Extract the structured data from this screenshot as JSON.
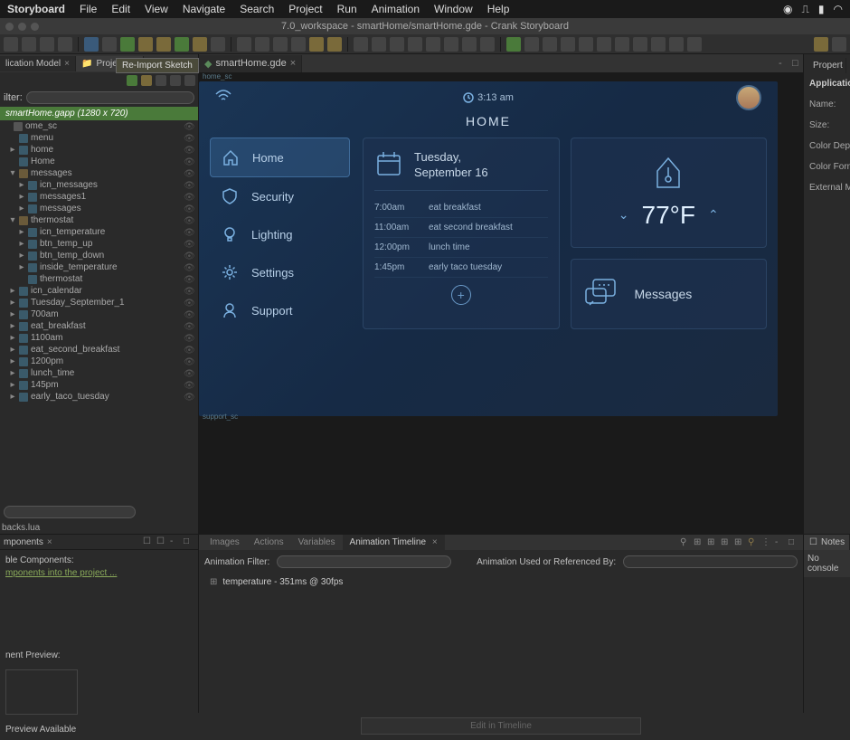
{
  "menubar": {
    "app": "Storyboard",
    "items": [
      "File",
      "Edit",
      "View",
      "Navigate",
      "Search",
      "Project",
      "Run",
      "Animation",
      "Window",
      "Help"
    ]
  },
  "titlebar": "7.0_workspace - smartHome/smartHome.gde - Crank Storyboard",
  "left": {
    "tab1": "lication Model",
    "tab2": "Project Ex",
    "tooltip": "Re-Import Sketch",
    "filter_label": "ilter:",
    "tree_header": "smartHome.gapp (1280 x 720)",
    "tree": [
      {
        "l": 0,
        "t": "",
        "label": "ome_sc"
      },
      {
        "l": 1,
        "t": "",
        "label": "menu",
        "icon": "layer"
      },
      {
        "l": 1,
        "t": "▸",
        "label": "home",
        "icon": "layer"
      },
      {
        "l": 1,
        "t": "",
        "label": "Home",
        "icon": "layer"
      },
      {
        "l": 1,
        "t": "▾",
        "label": "messages",
        "icon": "folder"
      },
      {
        "l": 2,
        "t": "▸",
        "label": "icn_messages",
        "icon": "layer"
      },
      {
        "l": 2,
        "t": "▸",
        "label": "messages1",
        "icon": "layer"
      },
      {
        "l": 2,
        "t": "▸",
        "label": "messages",
        "icon": "layer"
      },
      {
        "l": 1,
        "t": "▾",
        "label": "thermostat",
        "icon": "folder"
      },
      {
        "l": 2,
        "t": "▸",
        "label": "icn_temperature",
        "icon": "layer"
      },
      {
        "l": 2,
        "t": "▸",
        "label": "btn_temp_up",
        "icon": "layer"
      },
      {
        "l": 2,
        "t": "▸",
        "label": "btn_temp_down",
        "icon": "layer"
      },
      {
        "l": 2,
        "t": "▸",
        "label": "inside_temperature",
        "icon": "layer"
      },
      {
        "l": 2,
        "t": "",
        "label": "thermostat",
        "icon": "layer"
      },
      {
        "l": 1,
        "t": "▸",
        "label": "icn_calendar",
        "icon": "layer"
      },
      {
        "l": 1,
        "t": "▸",
        "label": "Tuesday_September_1",
        "icon": "layer"
      },
      {
        "l": 1,
        "t": "▸",
        "label": "700am",
        "icon": "layer"
      },
      {
        "l": 1,
        "t": "▸",
        "label": "eat_breakfast",
        "icon": "layer"
      },
      {
        "l": 1,
        "t": "▸",
        "label": "1100am",
        "icon": "layer"
      },
      {
        "l": 1,
        "t": "▸",
        "label": "eat_second_breakfast",
        "icon": "layer"
      },
      {
        "l": 1,
        "t": "▸",
        "label": "1200pm",
        "icon": "layer"
      },
      {
        "l": 1,
        "t": "▸",
        "label": "lunch_time",
        "icon": "layer"
      },
      {
        "l": 1,
        "t": "▸",
        "label": "145pm",
        "icon": "layer"
      },
      {
        "l": 1,
        "t": "▸",
        "label": "early_taco_tuesday",
        "icon": "layer"
      }
    ],
    "backs": "backs.lua"
  },
  "center": {
    "tab": "smartHome.gde",
    "label_top": "home_sc",
    "label_bottom": "support_sc"
  },
  "smarthome": {
    "time": "3:13 am",
    "title": "HOME",
    "nav": [
      "Home",
      "Security",
      "Lighting",
      "Settings",
      "Support"
    ],
    "date_day": "Tuesday,",
    "date_date": "September 16",
    "schedule": [
      {
        "time": "7:00am",
        "event": "eat breakfast"
      },
      {
        "time": "11:00am",
        "event": "eat second breakfast"
      },
      {
        "time": "12:00pm",
        "event": "lunch time"
      },
      {
        "time": "1:45pm",
        "event": "early taco tuesday"
      }
    ],
    "temperature": "77°F",
    "messages_label": "Messages"
  },
  "right": {
    "tab": "Propert",
    "section": "Applicatio",
    "rows": [
      "Name:",
      "Size:",
      "Color Dept",
      "Color Form",
      "External M"
    ]
  },
  "bottom": {
    "tabs": [
      "Images",
      "Actions",
      "Variables",
      "Animation Timeline"
    ],
    "filter_label": "Animation Filter:",
    "used_label": "Animation Used or Referenced By:",
    "anim_item": "temperature - 351ms @ 30fps",
    "edit_btn": "Edit in Timeline",
    "notes_tab": "Notes",
    "console_msg": "No console"
  },
  "components": {
    "tab": "mponents",
    "label": "ble Components:",
    "link": "mponents into the project ...",
    "preview_label": "nent Preview:",
    "no_preview": "Preview Available"
  }
}
